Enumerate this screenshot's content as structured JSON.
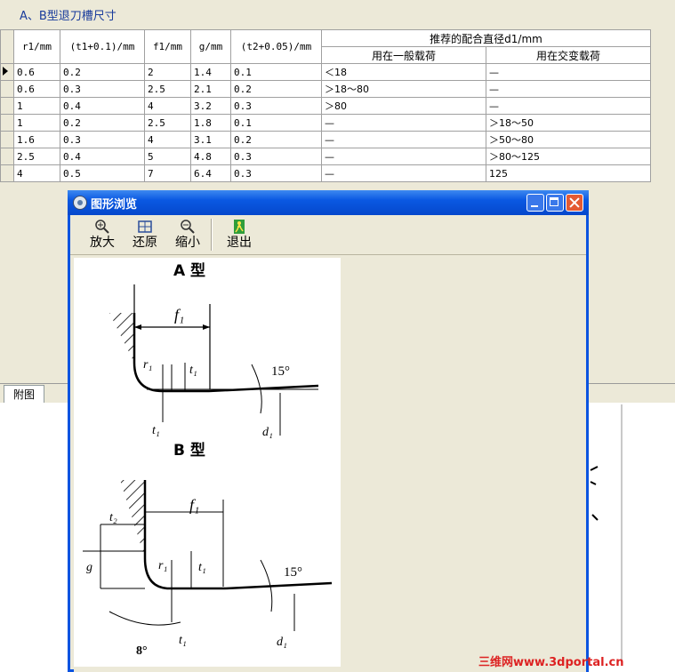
{
  "header": {
    "title": "A、B型退刀槽尺寸"
  },
  "table": {
    "columns": [
      "r1/mm",
      "(t1+0.1)/mm",
      "f1/mm",
      "g/mm",
      "(t2+0.05)/mm"
    ],
    "group_header": "推荐的配合直径d1/mm",
    "sub_columns": [
      "用在一般载荷",
      "用在交变载荷"
    ],
    "rows": [
      [
        "0.6",
        "0.2",
        "2",
        "1.4",
        "0.1",
        "＜18",
        "—"
      ],
      [
        "0.6",
        "0.3",
        "2.5",
        "2.1",
        "0.2",
        "＞18～80",
        "—"
      ],
      [
        "1",
        "0.4",
        "4",
        "3.2",
        "0.3",
        "＞80",
        "—"
      ],
      [
        "1",
        "0.2",
        "2.5",
        "1.8",
        "0.1",
        "—",
        "＞18～50"
      ],
      [
        "1.6",
        "0.3",
        "4",
        "3.1",
        "0.2",
        "—",
        "＞50～80"
      ],
      [
        "2.5",
        "0.4",
        "5",
        "4.8",
        "0.3",
        "—",
        "＞80～125"
      ],
      [
        "4",
        "0.5",
        "7",
        "6.4",
        "0.3",
        "—",
        "125"
      ]
    ]
  },
  "tabs": {
    "attachment": "附图"
  },
  "viewer_window": {
    "title": "图形浏览",
    "toolbar": {
      "zoom_in": "放大",
      "restore": "还原",
      "zoom_out": "缩小",
      "exit": "退出"
    },
    "drawing": {
      "a_title": "A 型",
      "b_title": "B 型",
      "labels": {
        "f1": "f₁",
        "r1": "r₁",
        "t1": "t₁",
        "t2": "t₂",
        "d1": "d₁",
        "g": "g",
        "angle15": "15°",
        "angle8": "8°"
      }
    }
  },
  "watermark": "三维网www.3dportal.cn"
}
